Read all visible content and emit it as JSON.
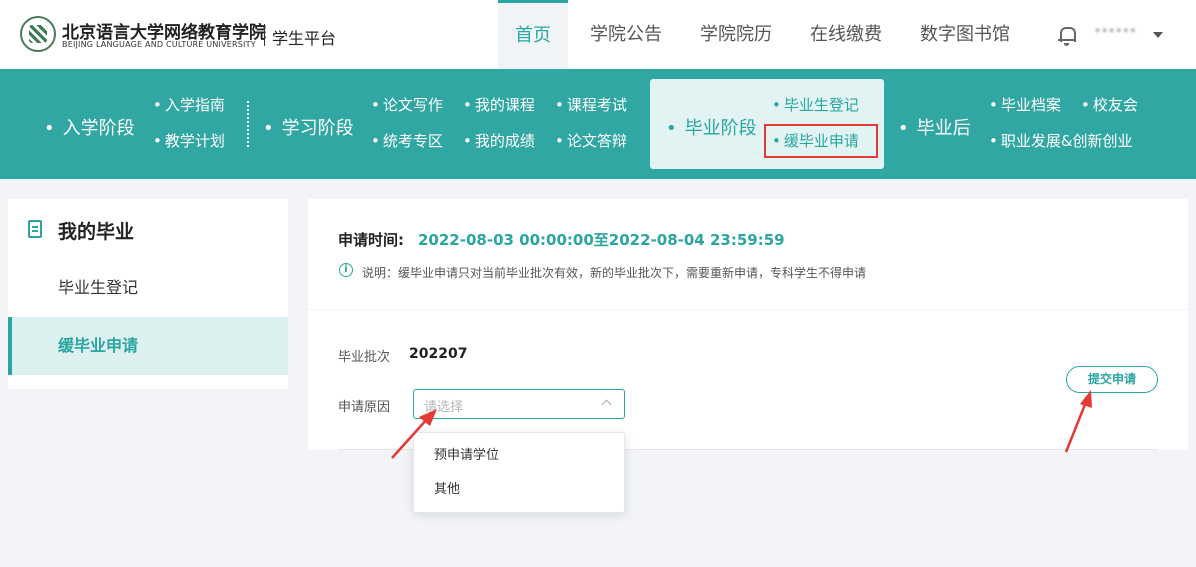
{
  "header": {
    "brand_cn": "北京语言大学网络教育学院",
    "brand_en": "BEIJING LANGUAGE AND CULTURE UNIVERSITY",
    "platform": "学生平台",
    "nav": [
      "首页",
      "学院公告",
      "学院院历",
      "在线缴费",
      "数字图书馆"
    ],
    "active_nav": "首页",
    "username": "••••••"
  },
  "stages": {
    "enrollment": {
      "label": "入学阶段",
      "subs": [
        "入学指南",
        "教学计划"
      ]
    },
    "study": {
      "label": "学习阶段",
      "subs": [
        "论文写作",
        "我的课程",
        "课程考试",
        "统考专区",
        "我的成绩",
        "论文答辩"
      ]
    },
    "graduation": {
      "label": "毕业阶段",
      "subs": [
        "毕业生登记",
        "缓毕业申请"
      ]
    },
    "after": {
      "label": "毕业后",
      "subs": [
        "毕业档案",
        "校友会",
        "职业发展&创新创业"
      ]
    }
  },
  "sidebar": {
    "title": "我的毕业",
    "items": [
      "毕业生登记",
      "缓毕业申请"
    ],
    "active": "缓毕业申请"
  },
  "application": {
    "time_label": "申请时间:",
    "time_value": "2022-08-03 00:00:00至2022-08-04 23:59:59",
    "note": "说明：缓毕业申请只对当前毕业批次有效，新的毕业批次下，需要重新申请，专科学生不得申请",
    "batch_label": "毕业批次",
    "batch_value": "202207",
    "reason_label": "申请原因",
    "reason_placeholder": "请选择",
    "reason_options": [
      "预申请学位",
      "其他"
    ],
    "submit_label": "提交申请"
  },
  "colors": {
    "accent": "#2aa5a0",
    "teal_bar": "#31a7a3",
    "highlight_red": "#e53935"
  }
}
